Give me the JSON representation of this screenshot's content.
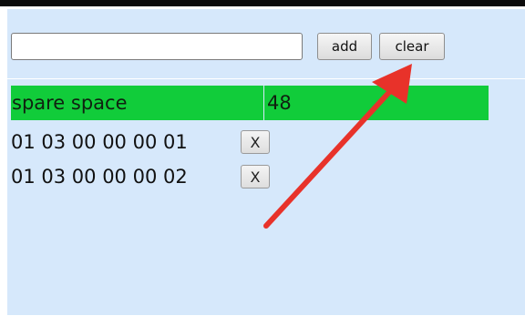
{
  "toolbar": {
    "input_value": "",
    "add_label": "add",
    "clear_label": "clear"
  },
  "summary": {
    "label": "spare space",
    "value": "48"
  },
  "items": [
    {
      "code": "01 03 00 00 00 01",
      "remove_label": "X"
    },
    {
      "code": "01 03 00 00 00 02",
      "remove_label": "X"
    }
  ],
  "colors": {
    "panel_background": "#d6e8fb",
    "summary_background": "#11cc3a",
    "annotation_arrow": "#e8322a"
  }
}
